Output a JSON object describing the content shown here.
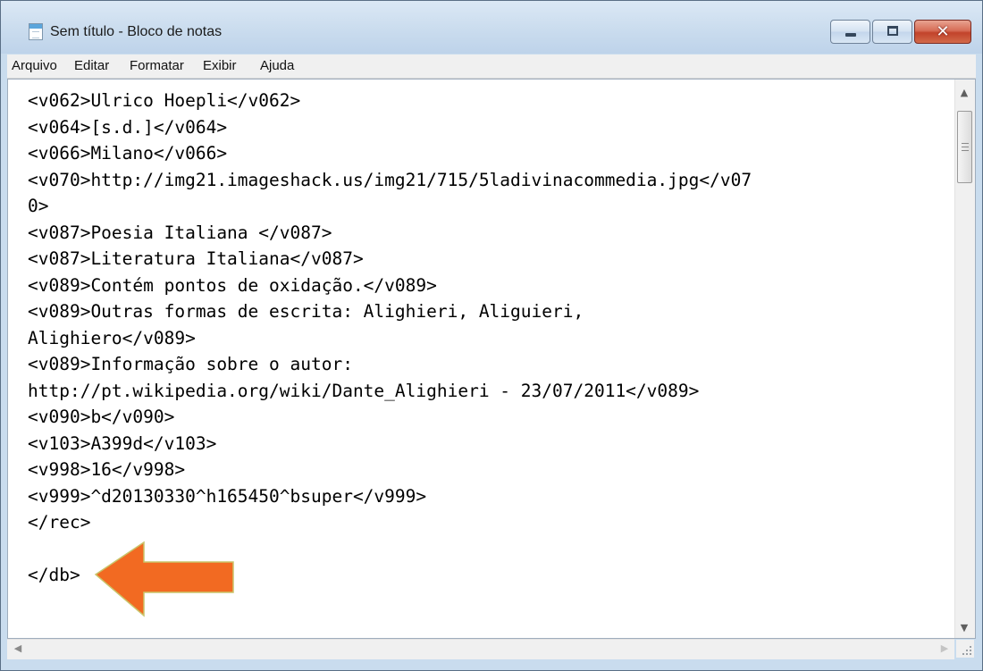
{
  "window": {
    "title": "Sem título - Bloco de notas"
  },
  "titlebar": {
    "minimize_icon": "minimize-icon",
    "maximize_icon": "maximize-icon",
    "close_glyph": "✕"
  },
  "menu": [
    "Arquivo",
    "Editar",
    "Formatar",
    "Exibir",
    "Ajuda"
  ],
  "editor": {
    "lines": [
      "<v062>Ulrico Hoepli</v062>",
      "<v064>[s.d.]</v064>",
      "<v066>Milano</v066>",
      "<v070>http://img21.imageshack.us/img21/715/5ladivinacommedia.jpg</v07",
      "0>",
      "<v087>Poesia Italiana </v087>",
      "<v087>Literatura Italiana</v087>",
      "<v089>Contém pontos de oxidação.</v089>",
      "<v089>Outras formas de escrita: Alighieri, Aliguieri,",
      "Alighiero</v089>",
      "<v089>Informação sobre o autor:",
      "http://pt.wikipedia.org/wiki/Dante_Alighieri - 23/07/2011</v089>",
      "<v090>b</v090>",
      "<v103>A399d</v103>",
      "<v998>16</v998>",
      "<v999>^d20130330^h165450^bsuper</v999>",
      "</rec>",
      "",
      "</db>"
    ]
  },
  "scrollbars": {
    "up_glyph": "▲",
    "down_glyph": "▼",
    "left_glyph": "◀",
    "right_glyph": "▶"
  },
  "annotation": {
    "icon": "orange-arrow-icon",
    "color": "#f26a22",
    "border_color": "#c9c46a"
  }
}
